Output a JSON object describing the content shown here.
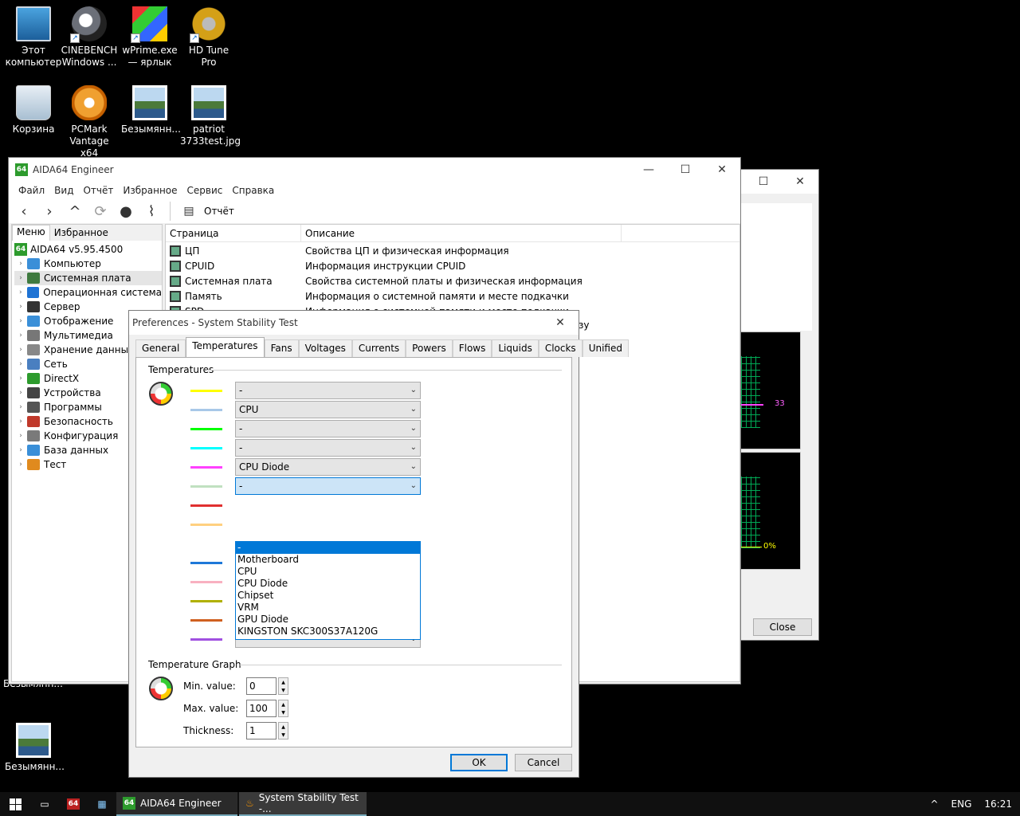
{
  "desktop": {
    "icons": [
      {
        "label": "Этот компьютер",
        "icon": "computer-icon"
      },
      {
        "label": "CINEBENCH Windows ...",
        "icon": "cinebench-icon"
      },
      {
        "label": "wPrime.exe — ярлык",
        "icon": "wprime-icon"
      },
      {
        "label": "HD Tune Pro",
        "icon": "hdtune-icon"
      },
      {
        "label": "Корзина",
        "icon": "recycle-bin-icon"
      },
      {
        "label": "PCMark Vantage x64",
        "icon": "pcmark-icon"
      },
      {
        "label": "Безымянн...",
        "icon": "image-file-icon"
      },
      {
        "label": "patriot 3733test.jpg",
        "icon": "image-file-icon"
      },
      {
        "label": "Безымянн...",
        "icon": "image-file-icon"
      },
      {
        "label": "Безымянн...",
        "icon": "image-file-icon"
      }
    ]
  },
  "main_window": {
    "title": "AIDA64 Engineer",
    "menu": [
      "Файл",
      "Вид",
      "Отчёт",
      "Избранное",
      "Сервис",
      "Справка"
    ],
    "report_label": "Отчёт",
    "panel_tabs": [
      "Меню",
      "Избранное"
    ],
    "tree_root": "AIDA64 v5.95.4500",
    "tree": [
      {
        "label": "Компьютер",
        "color": "#3a8fd8"
      },
      {
        "label": "Системная плата",
        "color": "#3f7a3f"
      },
      {
        "label": "Операционная система",
        "color": "#1e73d4"
      },
      {
        "label": "Сервер",
        "color": "#333333"
      },
      {
        "label": "Отображение",
        "color": "#3a8fd8"
      },
      {
        "label": "Мультимедиа",
        "color": "#777777"
      },
      {
        "label": "Хранение данных",
        "color": "#888888"
      },
      {
        "label": "Сеть",
        "color": "#4a7fc0"
      },
      {
        "label": "DirectX",
        "color": "#2d9b2d"
      },
      {
        "label": "Устройства",
        "color": "#444444"
      },
      {
        "label": "Программы",
        "color": "#555555"
      },
      {
        "label": "Безопасность",
        "color": "#c0392b"
      },
      {
        "label": "Конфигурация",
        "color": "#7a7a7a"
      },
      {
        "label": "База данных",
        "color": "#3a8fd8"
      },
      {
        "label": "Тест",
        "color": "#e08a1e"
      }
    ],
    "columns": [
      "Страница",
      "Описание"
    ],
    "rows": [
      {
        "page": "ЦП",
        "desc": "Свойства ЦП и физическая информация"
      },
      {
        "page": "CPUID",
        "desc": "Информация инструкции CPUID"
      },
      {
        "page": "Системная плата",
        "desc": "Свойства системной платы и физическая информация"
      },
      {
        "page": "Память",
        "desc": "Информация о системной памяти и месте подкачки"
      },
      {
        "page": "SPD",
        "desc": "Информация о системной памяти и месте подкачки"
      }
    ],
    "cut_off_text": "зу"
  },
  "back_window": {
    "close_label": "Close",
    "graph_value_1": "33",
    "graph_value_2": "0%"
  },
  "dialog": {
    "title": "Preferences - System Stability Test",
    "tabs": [
      "General",
      "Temperatures",
      "Fans",
      "Voltages",
      "Currents",
      "Powers",
      "Flows",
      "Liquids",
      "Clocks",
      "Unified"
    ],
    "active_tab": "Temperatures",
    "group_temps": "Temperatures",
    "sensors": [
      {
        "color": "#ffff00",
        "value": "-"
      },
      {
        "color": "#a8c8e8",
        "value": "CPU"
      },
      {
        "color": "#00ff00",
        "value": "-"
      },
      {
        "color": "#00ffff",
        "value": "-"
      },
      {
        "color": "#ff40ff",
        "value": "CPU Diode"
      },
      {
        "color": "#c0e0c0",
        "value": "-"
      },
      {
        "color": "#e03030",
        "value": ""
      },
      {
        "color": "#ffd080",
        "value": ""
      },
      {
        "color": "#ffffff",
        "value": ""
      },
      {
        "color": "#1e78d8",
        "value": ""
      },
      {
        "color": "#f8b0c0",
        "value": ""
      },
      {
        "color": "#b0b000",
        "value": "-"
      },
      {
        "color": "#d06020",
        "value": "-"
      },
      {
        "color": "#a050e0",
        "value": "-"
      }
    ],
    "dropdown_options": [
      "-",
      "Motherboard",
      "CPU",
      "CPU Diode",
      "Chipset",
      "VRM",
      "GPU Diode",
      "KINGSTON SKC300S37A120G"
    ],
    "dropdown_selected": "-",
    "group_graph": "Temperature Graph",
    "min_label": "Min. value:",
    "min_value": "0",
    "max_label": "Max. value:",
    "max_value": "100",
    "thickness_label": "Thickness:",
    "thickness_value": "1",
    "ok_label": "OK",
    "cancel_label": "Cancel"
  },
  "taskbar": {
    "tasks": [
      "AIDA64 Engineer",
      "System Stability Test -..."
    ],
    "lang": "ENG",
    "time": "16:21"
  }
}
